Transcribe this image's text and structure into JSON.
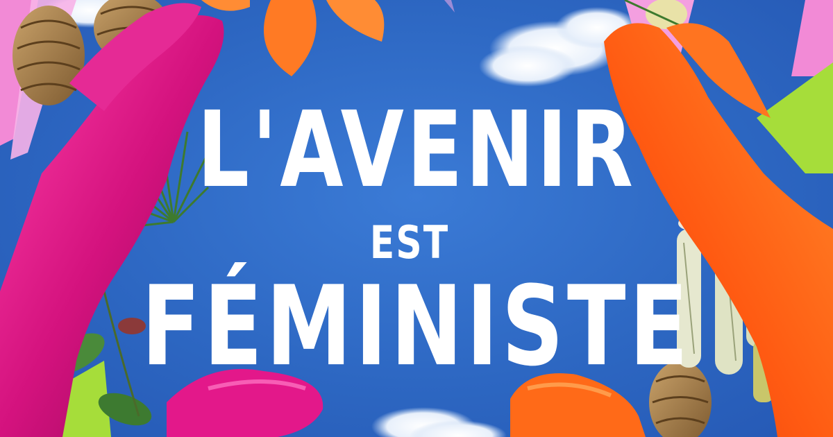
{
  "headline": {
    "line1": "L'AVENIR",
    "line2": "EST",
    "line3": "FÉMINISTE"
  },
  "colors": {
    "sky": "#2f6bc4",
    "text": "#ffffff",
    "left_hand": "#d4127e",
    "right_hand": "#ff6a1a",
    "stripe_pink": "#f28ad6",
    "stripe_green": "#a6dd3a"
  }
}
